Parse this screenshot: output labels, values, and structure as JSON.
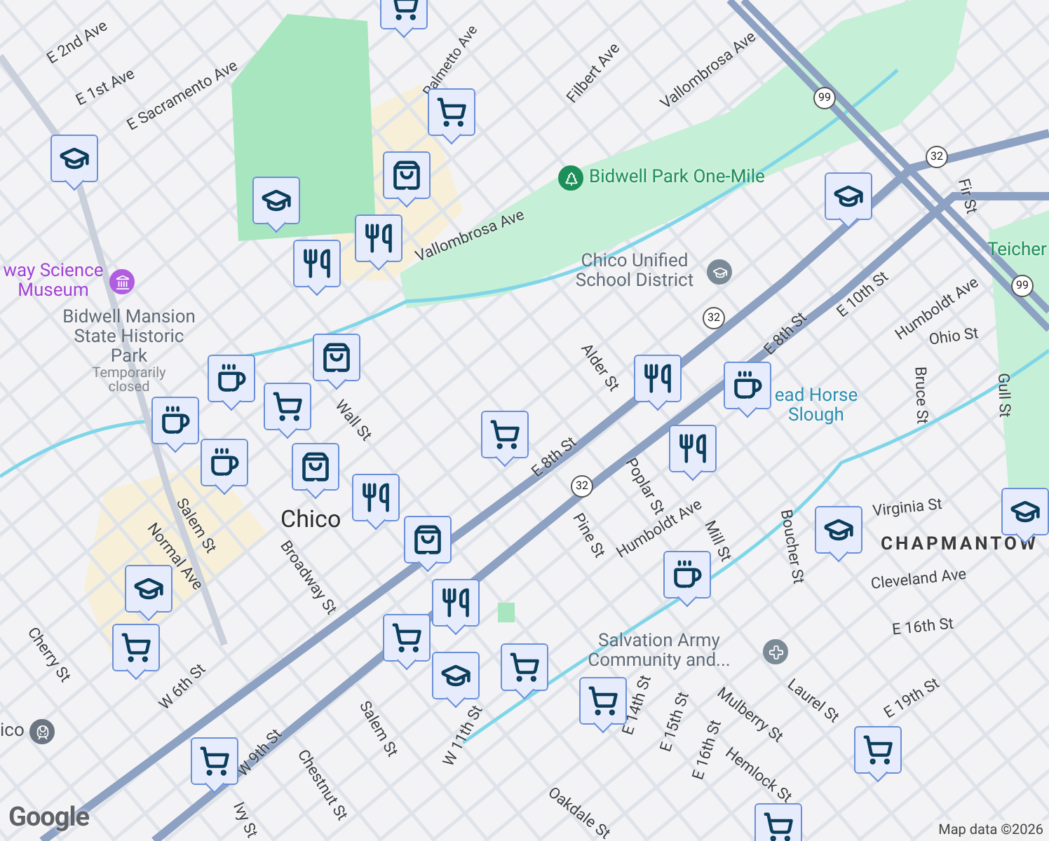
{
  "map": {
    "places": [
      {
        "kind": "park",
        "text": "Bidwell Park One-Mile"
      },
      {
        "kind": "area",
        "text": "Teicher"
      },
      {
        "kind": "museum",
        "text": "way Science Museum"
      },
      {
        "kind": "school",
        "text": "Chico Unified School District"
      },
      {
        "kind": "landmark",
        "text": "Bidwell Mansion State Historic Park",
        "note": "Temporarily closed"
      },
      {
        "kind": "water",
        "text": "ead Horse Slough"
      },
      {
        "kind": "city",
        "text": "Chico"
      },
      {
        "kind": "district",
        "text": "CHAPMANTOW"
      },
      {
        "kind": "church",
        "text": "Salvation Army Community and..."
      },
      {
        "kind": "station",
        "text": "ico"
      }
    ],
    "streets": [
      {
        "text": "E 2nd Ave"
      },
      {
        "text": "E 1st Ave"
      },
      {
        "text": "E Sacramento Ave"
      },
      {
        "text": "Palmetto Ave"
      },
      {
        "text": "Filbert Ave"
      },
      {
        "text": "Vallombrosa Ave"
      },
      {
        "text": "Vallombrosa Ave"
      },
      {
        "text": "E 10th St"
      },
      {
        "text": "Humboldt Ave"
      },
      {
        "text": "Ohio St"
      },
      {
        "text": "Alder St"
      },
      {
        "text": "E 8th St"
      },
      {
        "text": "E 8th St"
      },
      {
        "text": "Bruce St"
      },
      {
        "text": "Gull St"
      },
      {
        "text": "Poplar St"
      },
      {
        "text": "Pine St"
      },
      {
        "text": "Humboldt Ave"
      },
      {
        "text": "Mill St"
      },
      {
        "text": "Boucher St"
      },
      {
        "text": "Virginia St"
      },
      {
        "text": "Cleveland Ave"
      },
      {
        "text": "E 16th St"
      },
      {
        "text": "Laurel St"
      },
      {
        "text": "Mulberry St"
      },
      {
        "text": "E 19th St"
      },
      {
        "text": "E 14th St"
      },
      {
        "text": "E 15th St"
      },
      {
        "text": "E 16th St"
      },
      {
        "text": "Hemlock St"
      },
      {
        "text": "Oakdale St"
      },
      {
        "text": "Salem St"
      },
      {
        "text": "Normal Ave"
      },
      {
        "text": "Broadway St"
      },
      {
        "text": "Cherry St"
      },
      {
        "text": "W 6th St"
      },
      {
        "text": "W 9th St"
      },
      {
        "text": "Chestnut St"
      },
      {
        "text": "Salem St"
      },
      {
        "text": "W 11th St"
      },
      {
        "text": "Ivy St"
      },
      {
        "text": "Fir St"
      },
      {
        "text": "Wall St"
      }
    ],
    "route_shields": [
      {
        "text": "99"
      },
      {
        "text": "99"
      },
      {
        "text": "32"
      },
      {
        "text": "32"
      },
      {
        "text": "32"
      }
    ],
    "markers": [
      {
        "kind": "school"
      },
      {
        "kind": "school"
      },
      {
        "kind": "school"
      },
      {
        "kind": "school"
      },
      {
        "kind": "school"
      },
      {
        "kind": "school"
      },
      {
        "kind": "school"
      },
      {
        "kind": "grocery"
      },
      {
        "kind": "grocery"
      },
      {
        "kind": "grocery"
      },
      {
        "kind": "grocery"
      },
      {
        "kind": "grocery"
      },
      {
        "kind": "grocery"
      },
      {
        "kind": "grocery"
      },
      {
        "kind": "grocery"
      },
      {
        "kind": "grocery"
      },
      {
        "kind": "grocery"
      },
      {
        "kind": "grocery"
      },
      {
        "kind": "shop"
      },
      {
        "kind": "shop"
      },
      {
        "kind": "shop"
      },
      {
        "kind": "shop"
      },
      {
        "kind": "food"
      },
      {
        "kind": "food"
      },
      {
        "kind": "food"
      },
      {
        "kind": "food"
      },
      {
        "kind": "food"
      },
      {
        "kind": "food"
      },
      {
        "kind": "cafe"
      },
      {
        "kind": "cafe"
      },
      {
        "kind": "cafe"
      },
      {
        "kind": "cafe"
      },
      {
        "kind": "cafe"
      }
    ]
  },
  "logo": {
    "text": "Google"
  },
  "attribution": {
    "text": "Map data ©2026"
  }
}
